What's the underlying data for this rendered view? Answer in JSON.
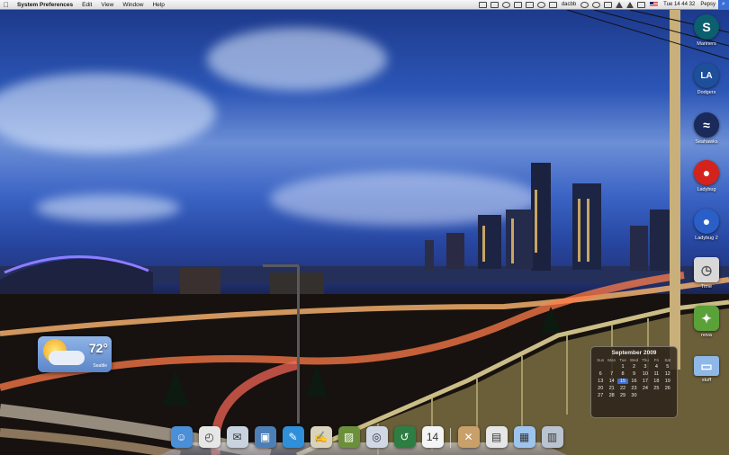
{
  "menubar": {
    "app_name": "System Preferences",
    "menus": [
      "Edit",
      "View",
      "Window",
      "Help"
    ],
    "status_text": "dacbb",
    "clock": "Tue 14 44 32",
    "user": "Pepsy"
  },
  "desktop_icons": [
    {
      "label": "Mariners",
      "icon": "mariners-logo-icon",
      "color": "#0c5f6e",
      "glyph": "S"
    },
    {
      "label": "Dodgers",
      "icon": "dodgers-logo-icon",
      "color": "#1d4f9a",
      "glyph": "LA"
    },
    {
      "label": "Seahawks",
      "icon": "seahawks-logo-icon",
      "color": "#1a2a5a",
      "glyph": "≈"
    },
    {
      "label": "Ladybug",
      "icon": "ladybug-icon",
      "color": "#d4231c",
      "glyph": "●"
    },
    {
      "label": "Ladybug 2",
      "icon": "ladybug-blue-icon",
      "color": "#2a5fc8",
      "glyph": "●"
    },
    {
      "label": "Time",
      "icon": "time-machine-drive-icon",
      "color": "#d8d8d8",
      "glyph": "◷"
    },
    {
      "label": "nova",
      "icon": "app-nova-icon",
      "color": "#5aa13a",
      "glyph": "✦"
    },
    {
      "label": "stuff",
      "icon": "folder-icon",
      "color": "#8fb8e8",
      "glyph": "▭"
    }
  ],
  "weather": {
    "temp": "72°",
    "city": "Seattle"
  },
  "calendar": {
    "title": "September 2009",
    "days": [
      "Sun",
      "Mon",
      "Tue",
      "Wed",
      "Thu",
      "Fri",
      "Sat"
    ],
    "dates": [
      "",
      "",
      "1",
      "2",
      "3",
      "4",
      "5",
      "6",
      "7",
      "8",
      "9",
      "10",
      "11",
      "12",
      "13",
      "14",
      "15",
      "16",
      "17",
      "18",
      "19",
      "20",
      "21",
      "22",
      "23",
      "24",
      "25",
      "26",
      "27",
      "28",
      "29",
      "30",
      "",
      "",
      ""
    ],
    "today": "15"
  },
  "dock": [
    {
      "name": "finder-icon",
      "color": "#4a8fd8",
      "glyph": "☺"
    },
    {
      "name": "dashboard-icon",
      "color": "#e6e6e6",
      "glyph": "◴"
    },
    {
      "name": "mail-icon",
      "color": "#c9d3df",
      "glyph": "✉"
    },
    {
      "name": "preview-icon",
      "color": "#4c7fb6",
      "glyph": "▣"
    },
    {
      "name": "pencil-app-icon",
      "color": "#2f8fd8",
      "glyph": "✎"
    },
    {
      "name": "script-editor-icon",
      "color": "#d9d3bd",
      "glyph": "✍"
    },
    {
      "name": "iphoto-icon",
      "color": "#6b8f3a",
      "glyph": "▨"
    },
    {
      "name": "safari-icon",
      "color": "#cfd8e4",
      "glyph": "◎"
    },
    {
      "name": "time-machine-icon",
      "color": "#2e7d42",
      "glyph": "↺"
    },
    {
      "name": "ical-icon",
      "color": "#f4f4f4",
      "glyph": "14"
    },
    {
      "name": "utilities-icon",
      "color": "#c8a06a",
      "glyph": "✕"
    },
    {
      "name": "document-icon",
      "color": "#e6e6e6",
      "glyph": "▤"
    },
    {
      "name": "applications-folder-icon",
      "color": "#9ec4ee",
      "glyph": "▦"
    },
    {
      "name": "trash-icon",
      "color": "#b9c4d0",
      "glyph": "▥"
    }
  ]
}
